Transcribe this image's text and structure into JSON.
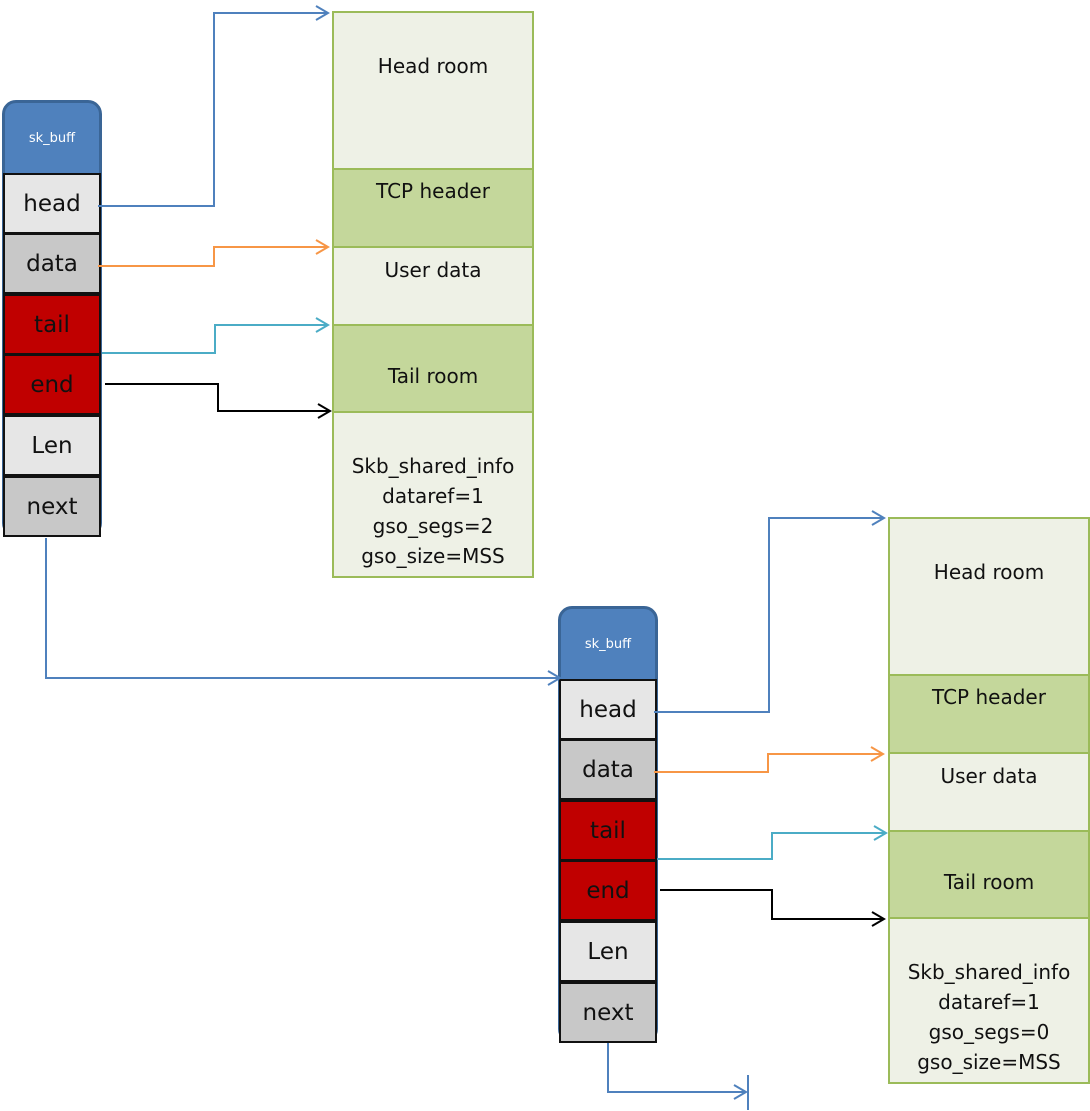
{
  "colors": {
    "skb_header": "#4f81bd",
    "field_light": "#e6e6e6",
    "field_gray": "#c8c8c8",
    "field_red": "#c00000",
    "buffer_light": "#eef1e6",
    "buffer_dark": "#c4d79b",
    "buffer_border": "#9bbb59",
    "arrow_head": "#4f81bd",
    "arrow_data": "#f79646",
    "arrow_tail": "#4bacc6",
    "arrow_end": "#000000",
    "arrow_next": "#4f81bd"
  },
  "skbs": [
    {
      "title": "sk_buff",
      "fields": [
        {
          "label": "head",
          "fill": "light"
        },
        {
          "label": "data",
          "fill": "gray"
        },
        {
          "label": "tail",
          "fill": "red"
        },
        {
          "label": "end",
          "fill": "red"
        },
        {
          "label": "Len",
          "fill": "light"
        },
        {
          "label": "next",
          "fill": "gray"
        }
      ]
    },
    {
      "title": "sk_buff",
      "fields": [
        {
          "label": "head",
          "fill": "light"
        },
        {
          "label": "data",
          "fill": "gray"
        },
        {
          "label": "tail",
          "fill": "red"
        },
        {
          "label": "end",
          "fill": "red"
        },
        {
          "label": "Len",
          "fill": "light"
        },
        {
          "label": "next",
          "fill": "gray"
        }
      ]
    }
  ],
  "buffers": [
    {
      "segments": [
        {
          "label": "Head room",
          "style": "light"
        },
        {
          "label": "TCP header",
          "style": "dark"
        },
        {
          "label": "User data",
          "style": "light"
        },
        {
          "label": "Tail room",
          "style": "dark"
        },
        {
          "label": "Skb_shared_info\ndataref=1\ngso_segs=2\ngso_size=MSS",
          "style": "light"
        }
      ]
    },
    {
      "segments": [
        {
          "label": "Head room",
          "style": "light"
        },
        {
          "label": "TCP header",
          "style": "dark"
        },
        {
          "label": "User data",
          "style": "light"
        },
        {
          "label": "Tail room",
          "style": "dark"
        },
        {
          "label": "Skb_shared_info\ndataref=1\ngso_segs=0\ngso_size=MSS",
          "style": "light"
        }
      ]
    }
  ],
  "pointers": [
    {
      "from": "skb1.head",
      "to": "buffer1.head-room-top",
      "color": "arrow_head"
    },
    {
      "from": "skb1.data",
      "to": "buffer1.user-data-top",
      "color": "arrow_data"
    },
    {
      "from": "skb1.tail",
      "to": "buffer1.tail-room-top",
      "color": "arrow_tail"
    },
    {
      "from": "skb1.end",
      "to": "buffer1.shared-info-top",
      "color": "arrow_end"
    },
    {
      "from": "skb1.next",
      "to": "skb2",
      "color": "arrow_next"
    },
    {
      "from": "skb2.head",
      "to": "buffer2.head-room-top",
      "color": "arrow_head"
    },
    {
      "from": "skb2.data",
      "to": "buffer2.user-data-top",
      "color": "arrow_data"
    },
    {
      "from": "skb2.tail",
      "to": "buffer2.tail-room-top",
      "color": "arrow_tail"
    },
    {
      "from": "skb2.end",
      "to": "buffer2.shared-info-top",
      "color": "arrow_end"
    },
    {
      "from": "skb2.next",
      "to": "null",
      "color": "arrow_next"
    }
  ]
}
